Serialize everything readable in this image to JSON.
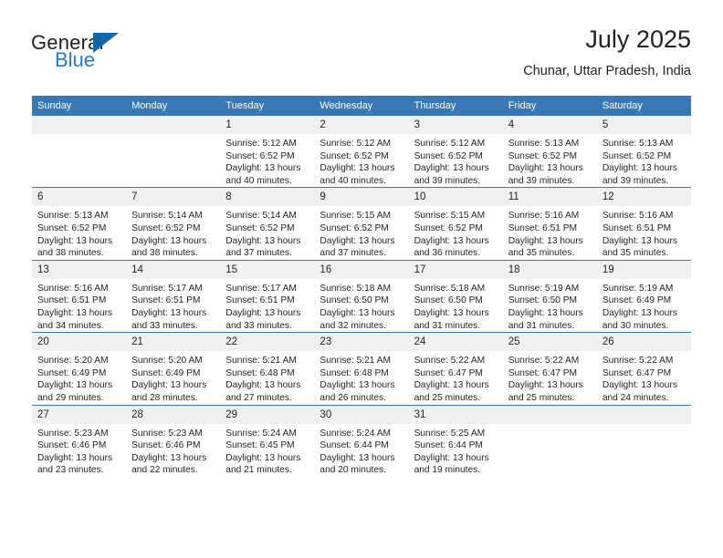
{
  "brand": {
    "name_top": "General",
    "name_bottom": "Blue",
    "color_dark": "#231f20",
    "color_blue": "#1f7bc4",
    "triangle_color": "#1165a8"
  },
  "header": {
    "title": "July 2025",
    "location": "Chunar, Uttar Pradesh, India"
  },
  "theme": {
    "header_blue": "#3a78b5",
    "daynum_band": "#f0f0f0",
    "grid_line": "#3a78b5"
  },
  "weekday_headers": [
    "Sunday",
    "Monday",
    "Tuesday",
    "Wednesday",
    "Thursday",
    "Friday",
    "Saturday"
  ],
  "weeks": [
    [
      {
        "day": "",
        "sunrise": "",
        "sunset": "",
        "daylight": ""
      },
      {
        "day": "",
        "sunrise": "",
        "sunset": "",
        "daylight": ""
      },
      {
        "day": "1",
        "sunrise": "Sunrise: 5:12 AM",
        "sunset": "Sunset: 6:52 PM",
        "daylight": "Daylight: 13 hours and 40 minutes."
      },
      {
        "day": "2",
        "sunrise": "Sunrise: 5:12 AM",
        "sunset": "Sunset: 6:52 PM",
        "daylight": "Daylight: 13 hours and 40 minutes."
      },
      {
        "day": "3",
        "sunrise": "Sunrise: 5:12 AM",
        "sunset": "Sunset: 6:52 PM",
        "daylight": "Daylight: 13 hours and 39 minutes."
      },
      {
        "day": "4",
        "sunrise": "Sunrise: 5:13 AM",
        "sunset": "Sunset: 6:52 PM",
        "daylight": "Daylight: 13 hours and 39 minutes."
      },
      {
        "day": "5",
        "sunrise": "Sunrise: 5:13 AM",
        "sunset": "Sunset: 6:52 PM",
        "daylight": "Daylight: 13 hours and 39 minutes."
      }
    ],
    [
      {
        "day": "6",
        "sunrise": "Sunrise: 5:13 AM",
        "sunset": "Sunset: 6:52 PM",
        "daylight": "Daylight: 13 hours and 38 minutes."
      },
      {
        "day": "7",
        "sunrise": "Sunrise: 5:14 AM",
        "sunset": "Sunset: 6:52 PM",
        "daylight": "Daylight: 13 hours and 38 minutes."
      },
      {
        "day": "8",
        "sunrise": "Sunrise: 5:14 AM",
        "sunset": "Sunset: 6:52 PM",
        "daylight": "Daylight: 13 hours and 37 minutes."
      },
      {
        "day": "9",
        "sunrise": "Sunrise: 5:15 AM",
        "sunset": "Sunset: 6:52 PM",
        "daylight": "Daylight: 13 hours and 37 minutes."
      },
      {
        "day": "10",
        "sunrise": "Sunrise: 5:15 AM",
        "sunset": "Sunset: 6:52 PM",
        "daylight": "Daylight: 13 hours and 36 minutes."
      },
      {
        "day": "11",
        "sunrise": "Sunrise: 5:16 AM",
        "sunset": "Sunset: 6:51 PM",
        "daylight": "Daylight: 13 hours and 35 minutes."
      },
      {
        "day": "12",
        "sunrise": "Sunrise: 5:16 AM",
        "sunset": "Sunset: 6:51 PM",
        "daylight": "Daylight: 13 hours and 35 minutes."
      }
    ],
    [
      {
        "day": "13",
        "sunrise": "Sunrise: 5:16 AM",
        "sunset": "Sunset: 6:51 PM",
        "daylight": "Daylight: 13 hours and 34 minutes."
      },
      {
        "day": "14",
        "sunrise": "Sunrise: 5:17 AM",
        "sunset": "Sunset: 6:51 PM",
        "daylight": "Daylight: 13 hours and 33 minutes."
      },
      {
        "day": "15",
        "sunrise": "Sunrise: 5:17 AM",
        "sunset": "Sunset: 6:51 PM",
        "daylight": "Daylight: 13 hours and 33 minutes."
      },
      {
        "day": "16",
        "sunrise": "Sunrise: 5:18 AM",
        "sunset": "Sunset: 6:50 PM",
        "daylight": "Daylight: 13 hours and 32 minutes."
      },
      {
        "day": "17",
        "sunrise": "Sunrise: 5:18 AM",
        "sunset": "Sunset: 6:50 PM",
        "daylight": "Daylight: 13 hours and 31 minutes."
      },
      {
        "day": "18",
        "sunrise": "Sunrise: 5:19 AM",
        "sunset": "Sunset: 6:50 PM",
        "daylight": "Daylight: 13 hours and 31 minutes."
      },
      {
        "day": "19",
        "sunrise": "Sunrise: 5:19 AM",
        "sunset": "Sunset: 6:49 PM",
        "daylight": "Daylight: 13 hours and 30 minutes."
      }
    ],
    [
      {
        "day": "20",
        "sunrise": "Sunrise: 5:20 AM",
        "sunset": "Sunset: 6:49 PM",
        "daylight": "Daylight: 13 hours and 29 minutes."
      },
      {
        "day": "21",
        "sunrise": "Sunrise: 5:20 AM",
        "sunset": "Sunset: 6:49 PM",
        "daylight": "Daylight: 13 hours and 28 minutes."
      },
      {
        "day": "22",
        "sunrise": "Sunrise: 5:21 AM",
        "sunset": "Sunset: 6:48 PM",
        "daylight": "Daylight: 13 hours and 27 minutes."
      },
      {
        "day": "23",
        "sunrise": "Sunrise: 5:21 AM",
        "sunset": "Sunset: 6:48 PM",
        "daylight": "Daylight: 13 hours and 26 minutes."
      },
      {
        "day": "24",
        "sunrise": "Sunrise: 5:22 AM",
        "sunset": "Sunset: 6:47 PM",
        "daylight": "Daylight: 13 hours and 25 minutes."
      },
      {
        "day": "25",
        "sunrise": "Sunrise: 5:22 AM",
        "sunset": "Sunset: 6:47 PM",
        "daylight": "Daylight: 13 hours and 25 minutes."
      },
      {
        "day": "26",
        "sunrise": "Sunrise: 5:22 AM",
        "sunset": "Sunset: 6:47 PM",
        "daylight": "Daylight: 13 hours and 24 minutes."
      }
    ],
    [
      {
        "day": "27",
        "sunrise": "Sunrise: 5:23 AM",
        "sunset": "Sunset: 6:46 PM",
        "daylight": "Daylight: 13 hours and 23 minutes."
      },
      {
        "day": "28",
        "sunrise": "Sunrise: 5:23 AM",
        "sunset": "Sunset: 6:46 PM",
        "daylight": "Daylight: 13 hours and 22 minutes."
      },
      {
        "day": "29",
        "sunrise": "Sunrise: 5:24 AM",
        "sunset": "Sunset: 6:45 PM",
        "daylight": "Daylight: 13 hours and 21 minutes."
      },
      {
        "day": "30",
        "sunrise": "Sunrise: 5:24 AM",
        "sunset": "Sunset: 6:44 PM",
        "daylight": "Daylight: 13 hours and 20 minutes."
      },
      {
        "day": "31",
        "sunrise": "Sunrise: 5:25 AM",
        "sunset": "Sunset: 6:44 PM",
        "daylight": "Daylight: 13 hours and 19 minutes."
      },
      {
        "day": "",
        "sunrise": "",
        "sunset": "",
        "daylight": ""
      },
      {
        "day": "",
        "sunrise": "",
        "sunset": "",
        "daylight": ""
      }
    ]
  ]
}
